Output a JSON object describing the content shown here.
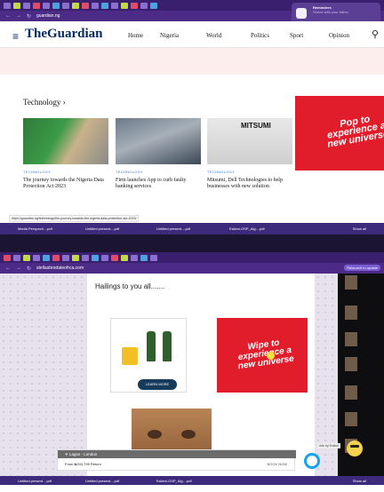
{
  "shot1": {
    "address": "guardian.ng",
    "notification": {
      "app": "Reminders",
      "text": "Shrine with your father"
    },
    "logo": "TheGuardian",
    "nav": [
      "Home",
      "Nigeria",
      "World",
      "Politics",
      "Sport",
      "Opinion"
    ],
    "section_title": "Technology",
    "section_arrow": "›",
    "cards": [
      {
        "tag": "TECHNOLOGY",
        "title": "The journey towards the Nigeria Data Protection Act 2023"
      },
      {
        "tag": "TECHNOLOGY",
        "title": "Firm launches App to curb faulty banking services"
      },
      {
        "tag": "TECHNOLOGY",
        "title": "Mitsumi, Dell Technologies to help businesses with new solution"
      }
    ],
    "card3_brand": "MITSUMI",
    "ad_text": "Pop to experience a new universe",
    "status_url": "https://guardian.ng/technology/the-journey-towards-the-nigeria-data-protection-act-2023/",
    "downloads": [
      "Media Perspecti....pdf",
      "Untitled present....pdf",
      "Untitled present....pdf",
      "Eskimi-OSP_Alg....pdf"
    ],
    "show_all": "Show all"
  },
  "shot2": {
    "address": "stellasbrodateofrca.com",
    "notification_btn": "Relaunch to update",
    "greeting": "Hailings to you all.......",
    "ad_learn": "LEARN MORE",
    "ad2_text": "Wipe to experience a new universe",
    "booking_route": "Lagos - London",
    "booking_price": "From ₦234,799 Return",
    "booking_cta": "BOOK NOW",
    "ads_by": "Ads by Eskimi",
    "downloads": [
      "Untitled present....pdf",
      "Untitled present....pdf",
      "Eskimi-OSP_Alg....pdf"
    ],
    "show_all": "Show all"
  }
}
